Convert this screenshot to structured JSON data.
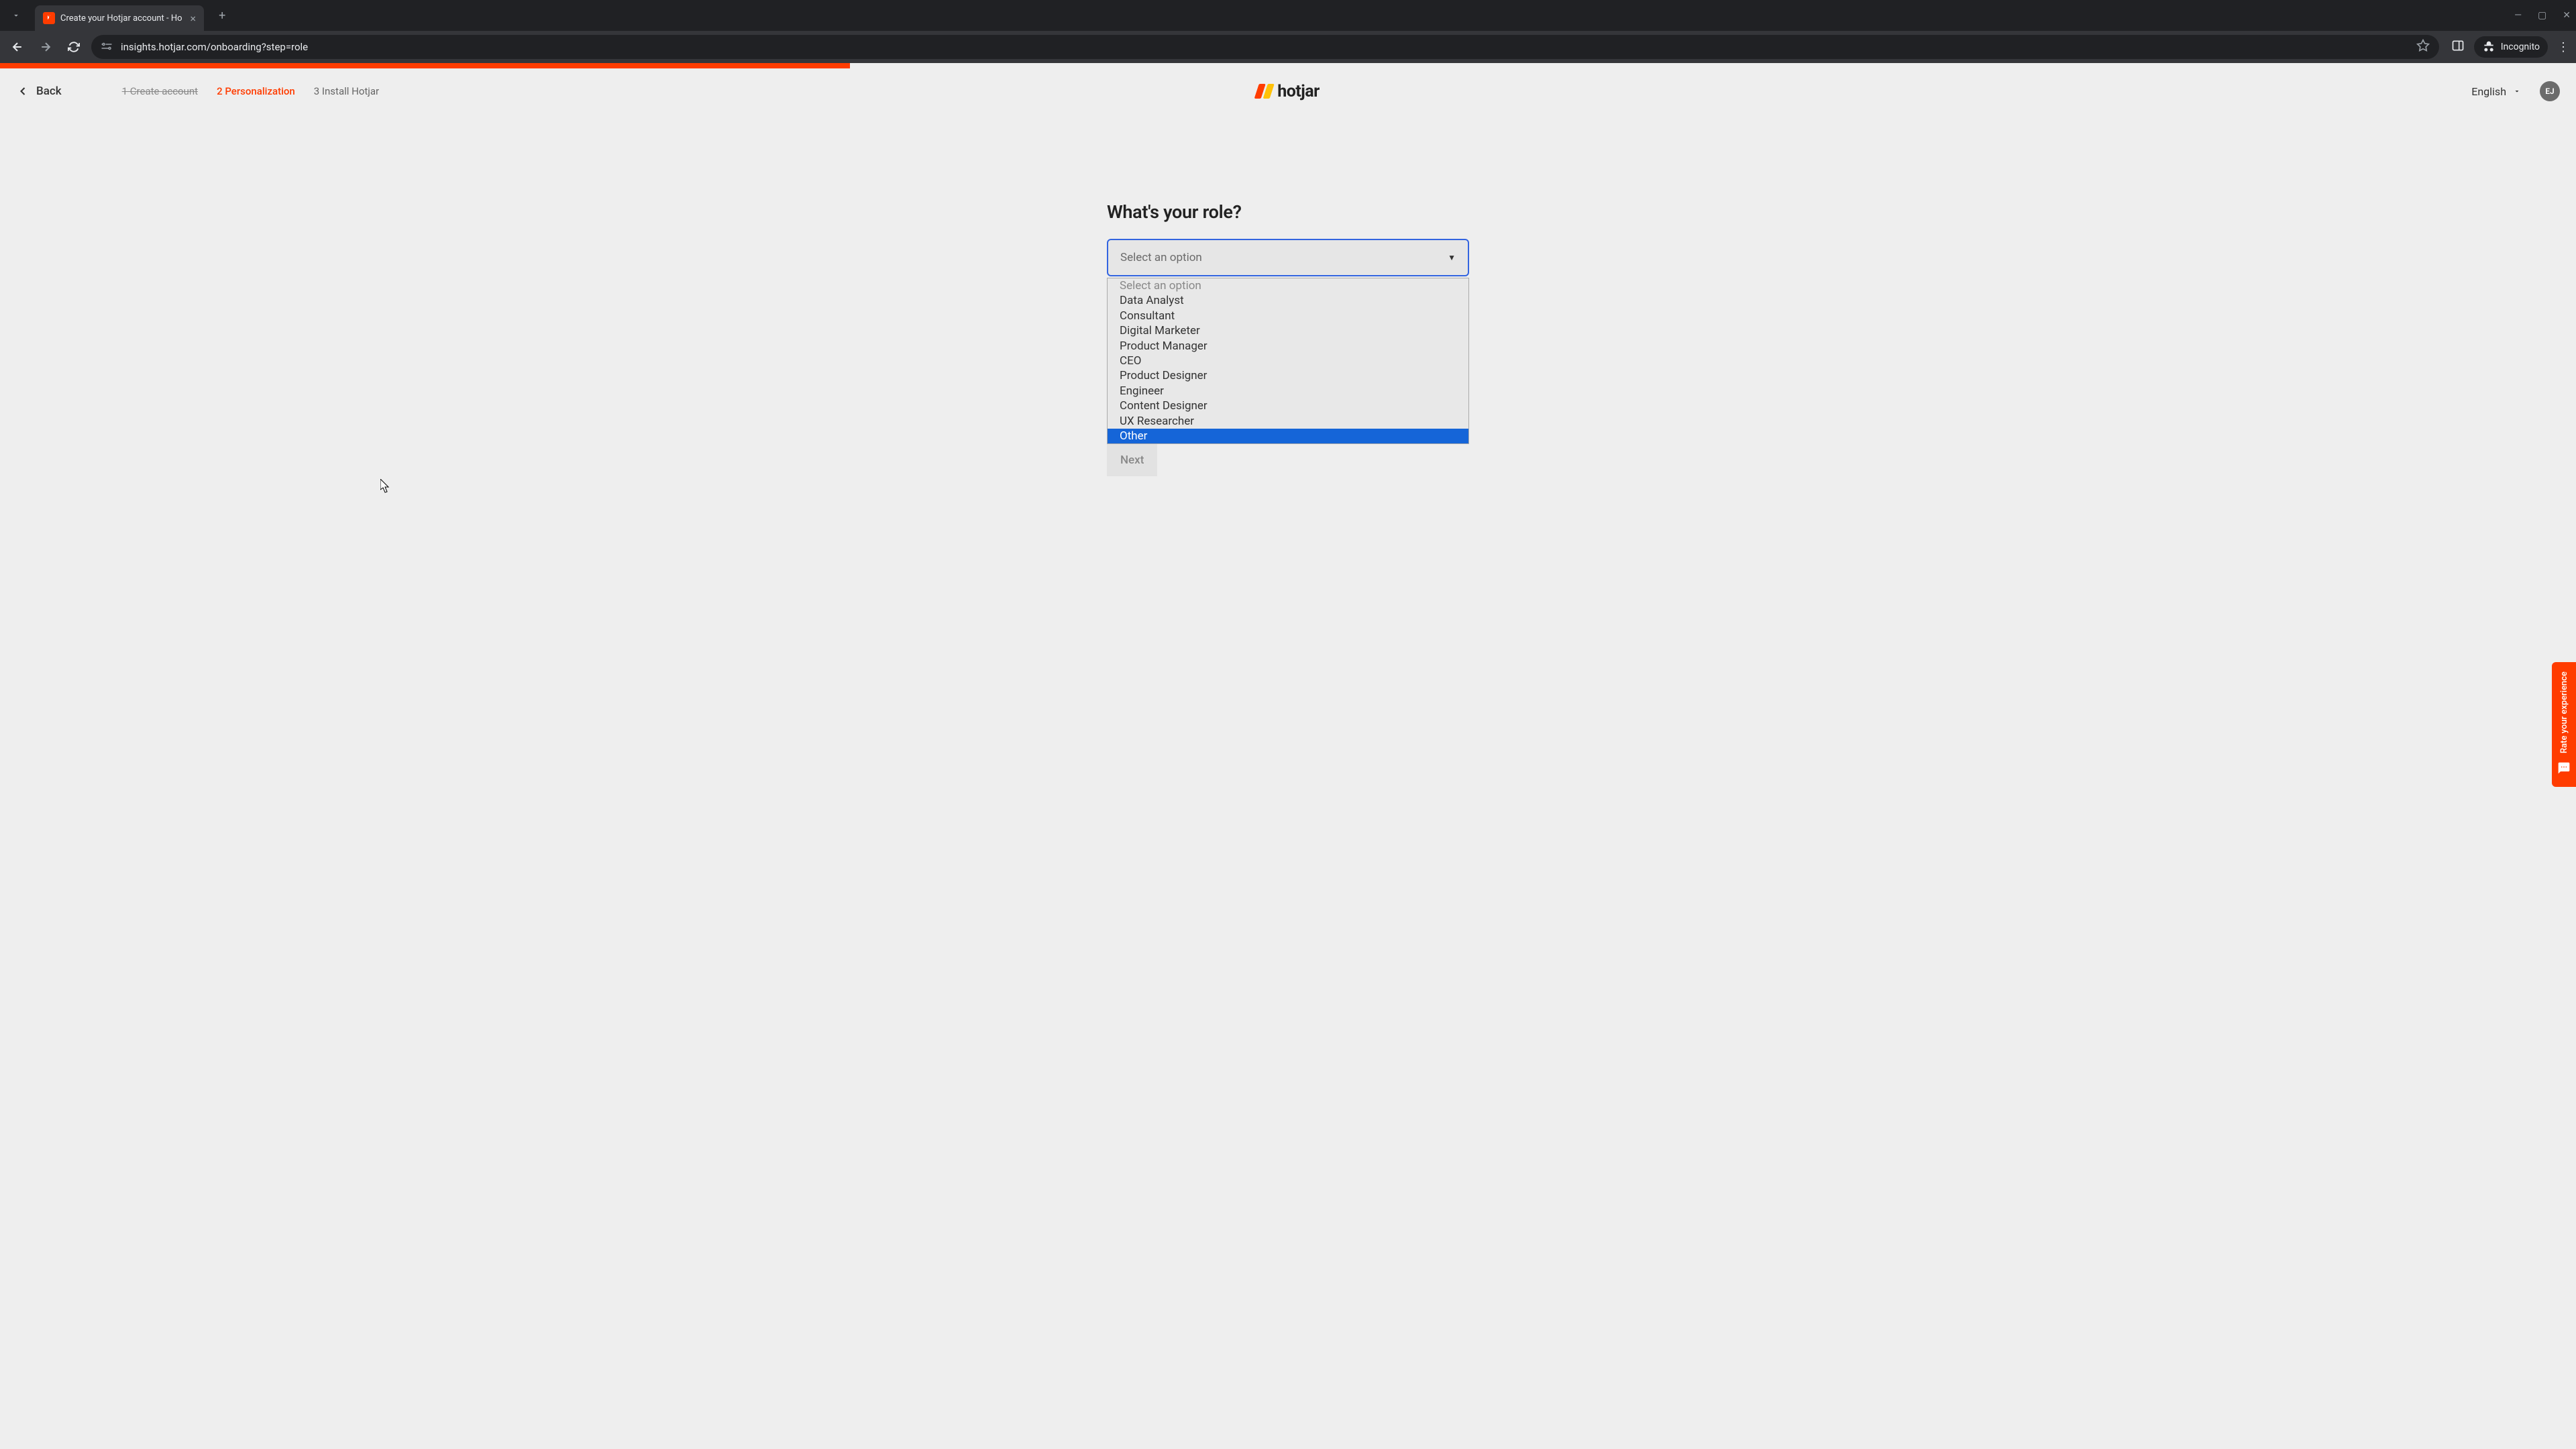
{
  "browser": {
    "tab_title": "Create your Hotjar account - Ho",
    "url": "insights.hotjar.com/onboarding?step=role",
    "incognito_label": "Incognito"
  },
  "header": {
    "back_label": "Back",
    "steps": {
      "step1": "1 Create account",
      "step2": "2 Personalization",
      "step3": "3 Install Hotjar"
    },
    "logo_text": "hotjar",
    "language": "English",
    "avatar_initials": "EJ"
  },
  "form": {
    "question": "What's your role?",
    "placeholder": "Select an option",
    "options": {
      "opt0": "Select an option",
      "opt1": "Data Analyst",
      "opt2": "Consultant",
      "opt3": "Digital Marketer",
      "opt4": "Product Manager",
      "opt5": "CEO",
      "opt6": "Product Designer",
      "opt7": "Engineer",
      "opt8": "Content Designer",
      "opt9": "UX Researcher",
      "opt10": "Other"
    },
    "next_label": "Next"
  },
  "feedback": {
    "label": "Rate your experience"
  }
}
